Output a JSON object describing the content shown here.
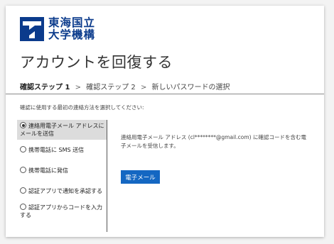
{
  "logo": {
    "line1": "東海国立",
    "line2": "大学機構",
    "brand_color": "#0b3b8c"
  },
  "page_title": "アカウントを回復する",
  "steps": {
    "current": "確認ステップ 1",
    "separator": ">",
    "step2": "確認ステップ 2",
    "step3": "新しいパスワードの選択"
  },
  "instruction": "確認に使用する最初の連絡方法を選択してください:",
  "options": [
    {
      "label": "連絡用電子メール アドレスにメールを送信",
      "selected": true
    },
    {
      "label": "携帯電話に SMS 送信",
      "selected": false
    },
    {
      "label": "携帯電話に発信",
      "selected": false
    },
    {
      "label": "認証アプリで通知を承認する",
      "selected": false
    },
    {
      "label": "認証アプリからコードを入力する",
      "selected": false
    }
  ],
  "detail_text": "連絡用電子メール アドレス (cl********@gmail.com) に確認コードを含む電子メールを受信します。",
  "button_label": "電子メール",
  "accent_color": "#1467c2"
}
